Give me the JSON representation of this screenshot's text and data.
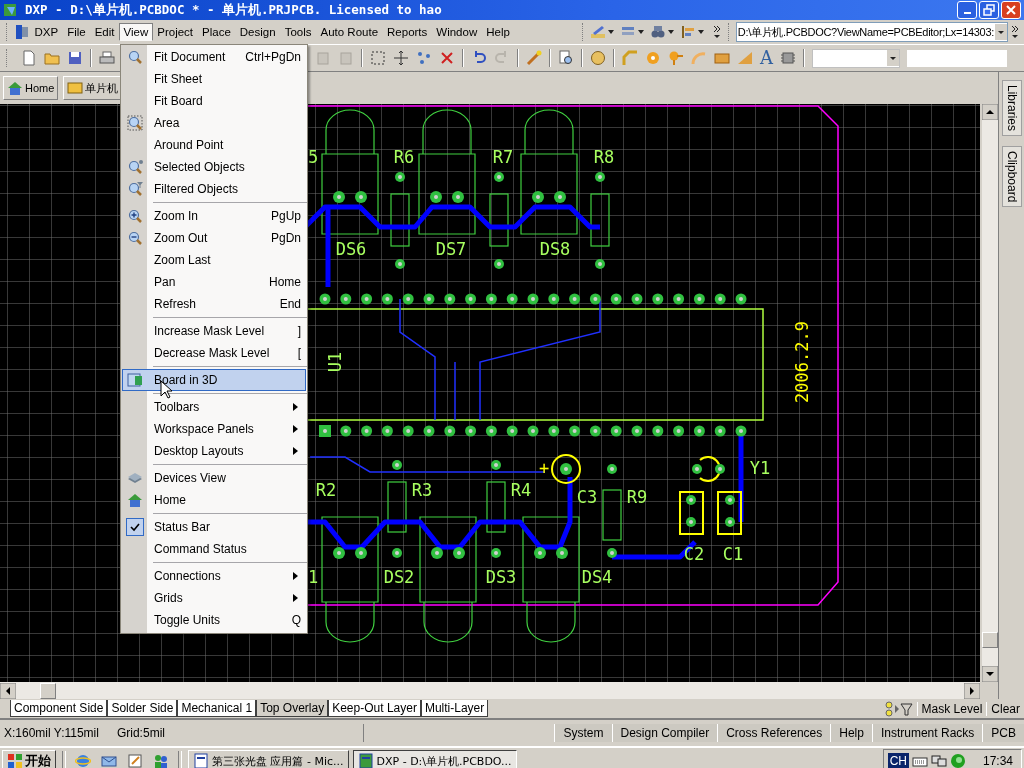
{
  "window": {
    "title": "DXP - D:\\单片机.PCBDOC * - 单片机.PRJPCB. Licensed to hao"
  },
  "menubar": {
    "logo": "DXP",
    "items": [
      {
        "label": "File",
        "selected": false
      },
      {
        "label": "Edit",
        "selected": false
      },
      {
        "label": "View",
        "selected": true
      },
      {
        "label": "Project",
        "selected": false
      },
      {
        "label": "Place",
        "selected": false
      },
      {
        "label": "Design",
        "selected": false
      },
      {
        "label": "Tools",
        "selected": false
      },
      {
        "label": "Auto Route",
        "selected": false
      },
      {
        "label": "Reports",
        "selected": false
      },
      {
        "label": "Window",
        "selected": false
      },
      {
        "label": "Help",
        "selected": false
      }
    ]
  },
  "address_field": {
    "value": "D:\\单片机.PCBDOC?ViewName=PCBEditor;Lx=14303:"
  },
  "toolbar": {
    "string_tool": "A"
  },
  "document_tabs": [
    "Home",
    "单片机"
  ],
  "side_panel_tabs": [
    "Libraries",
    "Clipboard"
  ],
  "pcb": {
    "labels": [
      {
        "text": "5",
        "color": "#a8ff60"
      },
      {
        "text": "R6",
        "color": "#a8ff60"
      },
      {
        "text": "R7",
        "color": "#a8ff60"
      },
      {
        "text": "R8",
        "color": "#a8ff60"
      },
      {
        "text": "DS6",
        "color": "#a8ff60"
      },
      {
        "text": "DS7",
        "color": "#a8ff60"
      },
      {
        "text": "DS8",
        "color": "#a8ff60"
      },
      {
        "text": "U1",
        "color": "#a8ff60"
      },
      {
        "text": "2006.2.9",
        "color": "#ffff00"
      },
      {
        "text": "+",
        "color": "#ffff00"
      },
      {
        "text": "R2",
        "color": "#a8ff60"
      },
      {
        "text": "R3",
        "color": "#a8ff60"
      },
      {
        "text": "R4",
        "color": "#a8ff60"
      },
      {
        "text": "C3",
        "color": "#a8ff60"
      },
      {
        "text": "R9",
        "color": "#a8ff60"
      },
      {
        "text": "Y1",
        "color": "#a8ff60"
      },
      {
        "text": "C2",
        "color": "#a8ff60"
      },
      {
        "text": "C1",
        "color": "#a8ff60"
      },
      {
        "text": "1",
        "color": "#a8ff60"
      },
      {
        "text": "DS2",
        "color": "#a8ff60"
      },
      {
        "text": "DS3",
        "color": "#a8ff60"
      },
      {
        "text": "DS4",
        "color": "#a8ff60"
      }
    ]
  },
  "view_menu": {
    "sections": [
      {
        "items": [
          {
            "label": "Fit Document",
            "shortcut": "Ctrl+PgDn",
            "submenu": false,
            "checked": false,
            "selected": false
          },
          {
            "label": "Fit Sheet",
            "submenu": false,
            "checked": false,
            "selected": false
          },
          {
            "label": "Fit Board",
            "submenu": false,
            "checked": false,
            "selected": false
          },
          {
            "label": "Area",
            "submenu": false,
            "checked": false,
            "selected": false
          },
          {
            "label": "Around Point",
            "submenu": false,
            "checked": false,
            "selected": false
          },
          {
            "label": "Selected Objects",
            "submenu": false,
            "checked": false,
            "selected": false
          },
          {
            "label": "Filtered Objects",
            "submenu": false,
            "checked": false,
            "selected": false
          }
        ]
      },
      {
        "items": [
          {
            "label": "Zoom In",
            "shortcut": "PgUp",
            "submenu": false,
            "checked": false,
            "selected": false
          },
          {
            "label": "Zoom Out",
            "shortcut": "PgDn",
            "submenu": false,
            "checked": false,
            "selected": false
          },
          {
            "label": "Zoom Last",
            "submenu": false,
            "checked": false,
            "selected": false
          },
          {
            "label": "Pan",
            "shortcut": "Home",
            "submenu": false,
            "checked": false,
            "selected": false
          },
          {
            "label": "Refresh",
            "shortcut": "End",
            "submenu": false,
            "checked": false,
            "selected": false
          }
        ]
      },
      {
        "items": [
          {
            "label": "Increase Mask Level",
            "shortcut": "]",
            "submenu": false,
            "checked": false,
            "selected": false
          },
          {
            "label": "Decrease Mask Level",
            "shortcut": "[",
            "submenu": false,
            "checked": false,
            "selected": false
          }
        ]
      },
      {
        "items": [
          {
            "label": "Board in 3D",
            "submenu": false,
            "checked": false,
            "selected": true
          }
        ]
      },
      {
        "items": [
          {
            "label": "Toolbars",
            "submenu": true,
            "checked": false,
            "selected": false
          },
          {
            "label": "Workspace Panels",
            "submenu": true,
            "checked": false,
            "selected": false
          },
          {
            "label": "Desktop Layouts",
            "submenu": true,
            "checked": false,
            "selected": false
          }
        ]
      },
      {
        "items": [
          {
            "label": "Devices View",
            "submenu": false,
            "checked": false,
            "selected": false
          },
          {
            "label": "Home",
            "submenu": false,
            "checked": false,
            "selected": false
          }
        ]
      },
      {
        "items": [
          {
            "label": "Status Bar",
            "submenu": false,
            "checked": true,
            "selected": false
          },
          {
            "label": "Command Status",
            "submenu": false,
            "checked": false,
            "selected": false
          }
        ]
      },
      {
        "items": [
          {
            "label": "Connections",
            "submenu": true,
            "checked": false,
            "selected": false
          },
          {
            "label": "Grids",
            "submenu": true,
            "checked": false,
            "selected": false
          },
          {
            "label": "Toggle Units",
            "shortcut": "Q",
            "submenu": false,
            "checked": false,
            "selected": false
          }
        ]
      }
    ]
  },
  "layer_tabs": [
    {
      "label": "Component Side",
      "selected": false
    },
    {
      "label": "Solder Side",
      "selected": false
    },
    {
      "label": "Mechanical 1",
      "selected": false
    },
    {
      "label": "Top Overlay",
      "selected": true
    },
    {
      "label": "Keep-Out Layer",
      "selected": false
    },
    {
      "label": "Multi-Layer",
      "selected": false
    }
  ],
  "mask": {
    "label": "Mask Level",
    "clear": "Clear"
  },
  "status_bar": {
    "position": "X:160mil Y:115mil",
    "grid": "Grid:5mil",
    "buttons": [
      "System",
      "Design Compiler",
      "Cross References",
      "Help",
      "Instrument Racks",
      "PCB"
    ]
  },
  "taskbar": {
    "start": "开始",
    "tasks": [
      {
        "label": "第三张光盘 应用篇 - Mic...",
        "selected": false
      },
      {
        "label": "DXP - D:\\单片机.PCBDO...",
        "selected": true
      }
    ],
    "language": "CH",
    "clock": "17:34"
  }
}
